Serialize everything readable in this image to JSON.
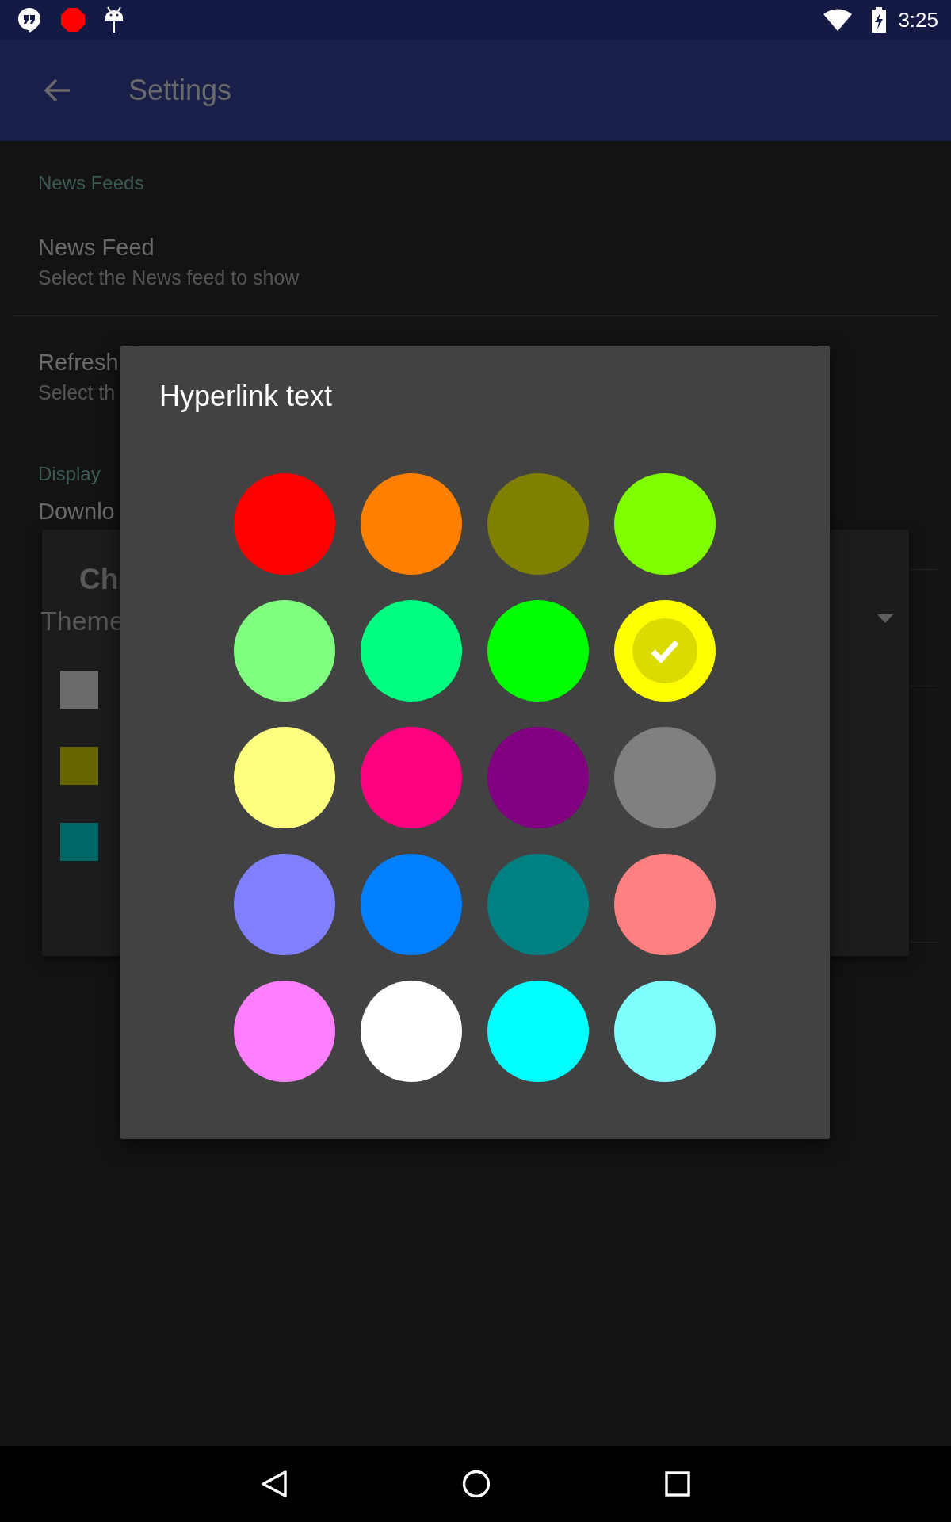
{
  "status_bar": {
    "time": "3:25"
  },
  "app_bar": {
    "title": "Settings"
  },
  "settings": [
    {
      "kind": "header",
      "title": "News Feeds"
    },
    {
      "kind": "item",
      "title": "News Feed",
      "summary": "Select the News feed to show",
      "divider": true
    },
    {
      "kind": "item",
      "title": "Refresh",
      "summary": "Select th",
      "divider": false
    },
    {
      "kind": "header",
      "title": "Display"
    },
    {
      "kind": "item",
      "title": "Downlo",
      "divider": false
    }
  ],
  "theme_dialog": {
    "title": "Ch",
    "subtitle": "Theme",
    "swatches": [
      {
        "color": "#6a6a6a"
      },
      {
        "color": "#666600"
      },
      {
        "color": "#006666"
      }
    ]
  },
  "color_dialog": {
    "title": "Hyperlink text",
    "colors": [
      {
        "color": "#ff0000",
        "selected": false
      },
      {
        "color": "#ff8000",
        "selected": false
      },
      {
        "color": "#808000",
        "selected": false
      },
      {
        "color": "#80ff00",
        "selected": false
      },
      {
        "color": "#80ff80",
        "selected": false
      },
      {
        "color": "#00ff80",
        "selected": false
      },
      {
        "color": "#00ff00",
        "selected": false
      },
      {
        "color": "#ffff00",
        "selected": true
      },
      {
        "color": "#ffff80",
        "selected": false
      },
      {
        "color": "#ff0080",
        "selected": false
      },
      {
        "color": "#800080",
        "selected": false
      },
      {
        "color": "#808080",
        "selected": false
      },
      {
        "color": "#8080ff",
        "selected": false
      },
      {
        "color": "#0080ff",
        "selected": false
      },
      {
        "color": "#008080",
        "selected": false
      },
      {
        "color": "#ff8080",
        "selected": false
      },
      {
        "color": "#ff80ff",
        "selected": false
      },
      {
        "color": "#ffffff",
        "selected": false
      },
      {
        "color": "#00ffff",
        "selected": false
      },
      {
        "color": "#80ffff",
        "selected": false
      }
    ]
  }
}
